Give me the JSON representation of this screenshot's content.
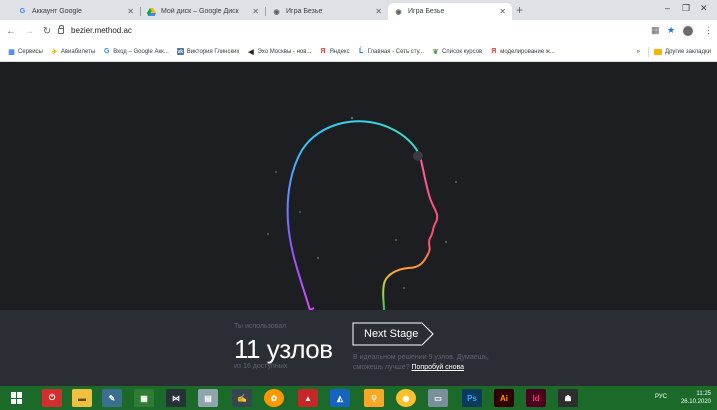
{
  "tabs": [
    {
      "title": "Аккаунт Google",
      "favicon": "google-icon"
    },
    {
      "title": "Мой диск – Google Диск",
      "favicon": "drive-icon"
    },
    {
      "title": "Игра Безье",
      "favicon": "globe-icon"
    },
    {
      "title": "Игра Безье",
      "favicon": "globe-icon",
      "active": true
    }
  ],
  "address": {
    "url": "bezier.method.ac"
  },
  "bookmarks": [
    {
      "label": "Сервисы",
      "icon": "apps-icon"
    },
    {
      "label": "Авиабилеты",
      "icon": "plane-icon"
    },
    {
      "label": "Вход – Google Акк...",
      "icon": "google-icon"
    },
    {
      "label": "Виктория Глинских",
      "icon": "vk-icon"
    },
    {
      "label": "Эхо Москвы - нов...",
      "icon": "echo-icon"
    },
    {
      "label": "Яндекс",
      "icon": "yandex-icon"
    },
    {
      "label": "Главная - Сеть сту...",
      "icon": "edu-icon"
    },
    {
      "label": "Список курсов",
      "icon": "leaf-icon"
    },
    {
      "label": "моделирование ж...",
      "icon": "yandex-icon"
    }
  ],
  "bookmarks_more": "»",
  "other_bookmarks": "Другие закладки",
  "game": {
    "used_label": "Ты использовал",
    "count": "11 узлов",
    "available": "из 16 доступных",
    "next_stage": "Next Stage",
    "hint_text": "В идеальном решении 9 узлов. Думаешь, сможешь лучше?",
    "hint_link": "Попробуй снова"
  },
  "taskbar": {
    "lang": "РУС",
    "time": "11:25",
    "date": "26.10.2020"
  },
  "colors": {
    "canvas": "#1d1e22",
    "panel": "#2a2d34",
    "taskbar": "#1c6a2a"
  }
}
